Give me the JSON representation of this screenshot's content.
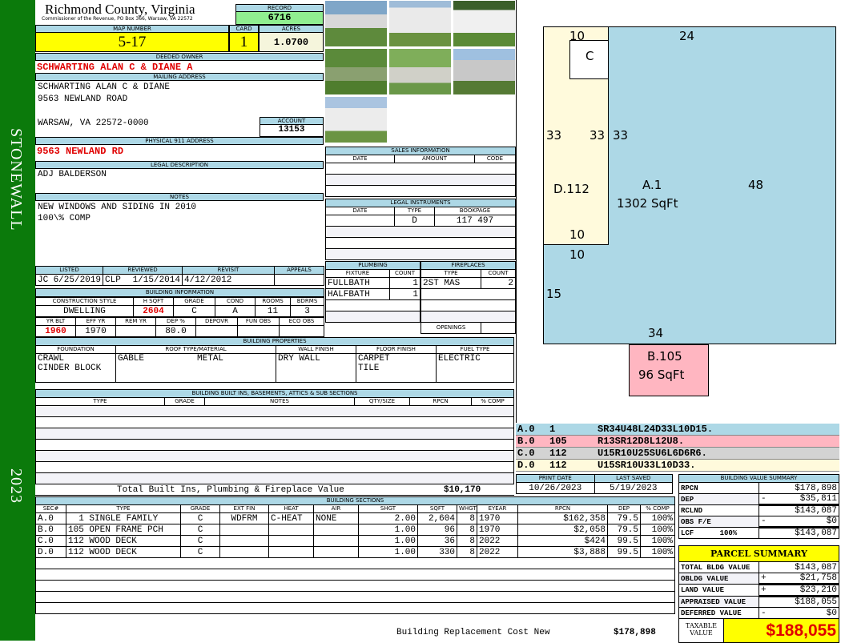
{
  "sidebar": {
    "district": "STONEWALL",
    "year": "2023"
  },
  "header": {
    "county": "Richmond County, Virginia",
    "subtitle": "Commissioner of the Revenue, PO Box 366, Warsaw, VA 22572",
    "record_label": "RECORD",
    "record": "6716"
  },
  "parcel": {
    "map_label": "MAP NUMBER",
    "map": "5-17",
    "card_label": "CARD",
    "card": "1",
    "acres_label": "ACRES",
    "acres": "1.0700"
  },
  "owner": {
    "label": "DEEDED OWNER",
    "value": "SCHWARTING ALAN C & DIANE A"
  },
  "mailing": {
    "label": "MAILING ADDRESS",
    "line1": "SCHWARTING ALAN C & DIANE",
    "line2": "9563 NEWLAND ROAD",
    "line3": "WARSAW, VA 22572-0000",
    "account_label": "ACCOUNT",
    "account": "13153"
  },
  "physical": {
    "label": "PHYSICAL 911 ADDRESS",
    "value": "9563 NEWLAND RD"
  },
  "legal_desc": {
    "label": "LEGAL DESCRIPTION",
    "value": "ADJ BALDERSON"
  },
  "notes": {
    "label": "NOTES",
    "line1": "NEW WINDOWS AND SIDING IN 2010",
    "line2": "100\\% COMP"
  },
  "dates": {
    "listed_label": "LISTED",
    "listed_by": "JC",
    "listed": "6/25/2019",
    "reviewed_label": "REVIEWED",
    "reviewed_by": "CLP",
    "reviewed": "1/15/2014",
    "revisit_label": "REVISIT",
    "revisit": "4/12/2012",
    "appeals_label": "APPEALS"
  },
  "bldg_info": {
    "label": "BUILDING INFORMATION",
    "h1": [
      "CONSTRUCTION STYLE",
      "H SQFT",
      "GRADE",
      "COND",
      "ROOMS",
      "BDRMS"
    ],
    "v1": [
      "DWELLING",
      "2604",
      "C",
      "A",
      "11",
      "3"
    ],
    "h2": [
      "YR BLT",
      "EFF YR",
      "REM YR",
      "DEP %",
      "DEPOVR",
      "FUN OBS",
      "ECO OBS"
    ],
    "v2": [
      "1960",
      "1970",
      "",
      "80.0",
      "",
      "",
      ""
    ]
  },
  "sales": {
    "label": "SALES INFORMATION",
    "headers": [
      "DATE",
      "AMOUNT",
      "CODE"
    ]
  },
  "legal": {
    "label": "LEGAL INSTRUMENTS",
    "headers": [
      "DATE",
      "TYPE",
      "BOOKPAGE"
    ],
    "rows": [
      [
        "",
        "D",
        "117 497"
      ]
    ]
  },
  "plumbing": {
    "label": "PLUMBING",
    "headers": [
      "FIXTURE",
      "COUNT"
    ],
    "rows": [
      [
        "FULLBATH",
        "1"
      ],
      [
        "HALFBATH",
        "1"
      ]
    ]
  },
  "fireplaces": {
    "label": "FIREPLACES",
    "headers": [
      "TYPE",
      "COUNT"
    ],
    "rows": [
      [
        "2ST MAS",
        "2"
      ]
    ],
    "openings_label": "OPENINGS"
  },
  "props": {
    "label": "BUILDING PROPERTIES",
    "headers": [
      "FOUNDATION",
      "ROOF TYPE/MATERIAL",
      "WALL FINISH",
      "FLOOR FINISH",
      "FUEL TYPE"
    ],
    "foundation": "CRAWL\nCINDER BLOCK",
    "roof": "GABLE          METAL",
    "wall": "DRY WALL",
    "floor": "CARPET\nTILE",
    "fuel": "ELECTRIC"
  },
  "builtins": {
    "label": "BUILDING BUILT INS, BASEMENTS, ATTICS & SUB SECTIONS",
    "headers": [
      "TYPE",
      "GRADE",
      "NOTES",
      "QTY/SIZE",
      "RPCN",
      "% COMP"
    ],
    "total_label": "Total Built Ins, Plumbing & Fireplace Value",
    "total": "$10,170"
  },
  "sections": {
    "label": "BUILDING SECTIONS",
    "headers": [
      "SEC#",
      "TYPE",
      "GRADE",
      "EXT FIN",
      "HEAT",
      "AIR",
      "SHGT",
      "SQFT",
      "WHGT",
      "EYEAR",
      "RPCN",
      "DEP",
      "% COMP"
    ],
    "rows": [
      [
        "A.0",
        "  1 SINGLE FAMILY",
        "C",
        "WDFRM",
        "C-HEAT",
        "NONE",
        "2.00",
        "2,604",
        "8",
        "1970",
        "$162,358",
        "79.5",
        "100%"
      ],
      [
        "B.0",
        "105 OPEN FRAME PCH",
        "C",
        "",
        "",
        "",
        "1.00",
        "96",
        "8",
        "1970",
        "$2,058",
        "79.5",
        "100%"
      ],
      [
        "C.0",
        "112 WOOD DECK",
        "C",
        "",
        "",
        "",
        "1.00",
        "36",
        "8",
        "2022",
        "$424",
        "99.5",
        "100%"
      ],
      [
        "D.0",
        "112 WOOD DECK",
        "C",
        "",
        "",
        "",
        "1.00",
        "330",
        "8",
        "2022",
        "$3,888",
        "99.5",
        "100%"
      ]
    ],
    "total_label": "Building Replacement Cost New",
    "total": "$178,898"
  },
  "sketch": {
    "labels": {
      "a_name": "A.1",
      "a_area": "1302 SqFt",
      "b_name": "B.105",
      "b_area": "96 SqFt",
      "c_name": "C",
      "d_name": "D.112"
    },
    "dims": {
      "top_left": "10",
      "top": "24",
      "c_side": "33",
      "d_left": "33",
      "d_right": "33",
      "right": "48",
      "d_bottom": "10",
      "a_step": "10",
      "left": "15",
      "bottom": "34"
    }
  },
  "legend": [
    {
      "sec": "A.0",
      "code": "1",
      "path": "SR34U48L24D33L10D15.",
      "color": "#add8e6"
    },
    {
      "sec": "B.0",
      "code": "105",
      "path": "R13SR12D8L12U8.",
      "color": "#ffb6c1"
    },
    {
      "sec": "C.0",
      "code": "112",
      "path": "U15R10U25SU6L6D6R6.",
      "color": "#d3d3d3"
    },
    {
      "sec": "D.0",
      "code": "112",
      "path": "U15SR10U33L10D33.",
      "color": "#fffadc"
    }
  ],
  "print": {
    "print_label": "PRINT DATE",
    "print_date": "10/26/2023",
    "saved_label": "LAST SAVED",
    "saved": "5/19/2023"
  },
  "bvs": {
    "label": "BUILDING VALUE SUMMARY",
    "rows": [
      [
        "RPCN",
        "",
        "$178,898"
      ],
      [
        "DEP",
        "-",
        "$35,811"
      ],
      [
        "RCLND",
        "",
        "$143,087"
      ],
      [
        "OBS F/E",
        "-",
        "$0"
      ],
      [
        "LCF      100%",
        "",
        "$143,087"
      ]
    ]
  },
  "summary": {
    "title": "PARCEL SUMMARY",
    "rows": [
      [
        "TOTAL BLDG VALUE",
        "",
        "$143,087"
      ],
      [
        "OBLDG VALUE",
        "+",
        "$21,758"
      ],
      [
        "LAND VALUE",
        "+",
        "$23,210"
      ],
      [
        "APPRAISED VALUE",
        "",
        "$188,055"
      ],
      [
        "DEFERRED VALUE",
        "-",
        "$0"
      ]
    ],
    "taxable_label": "TAXABLE\nVALUE",
    "taxable": "$188,055"
  }
}
